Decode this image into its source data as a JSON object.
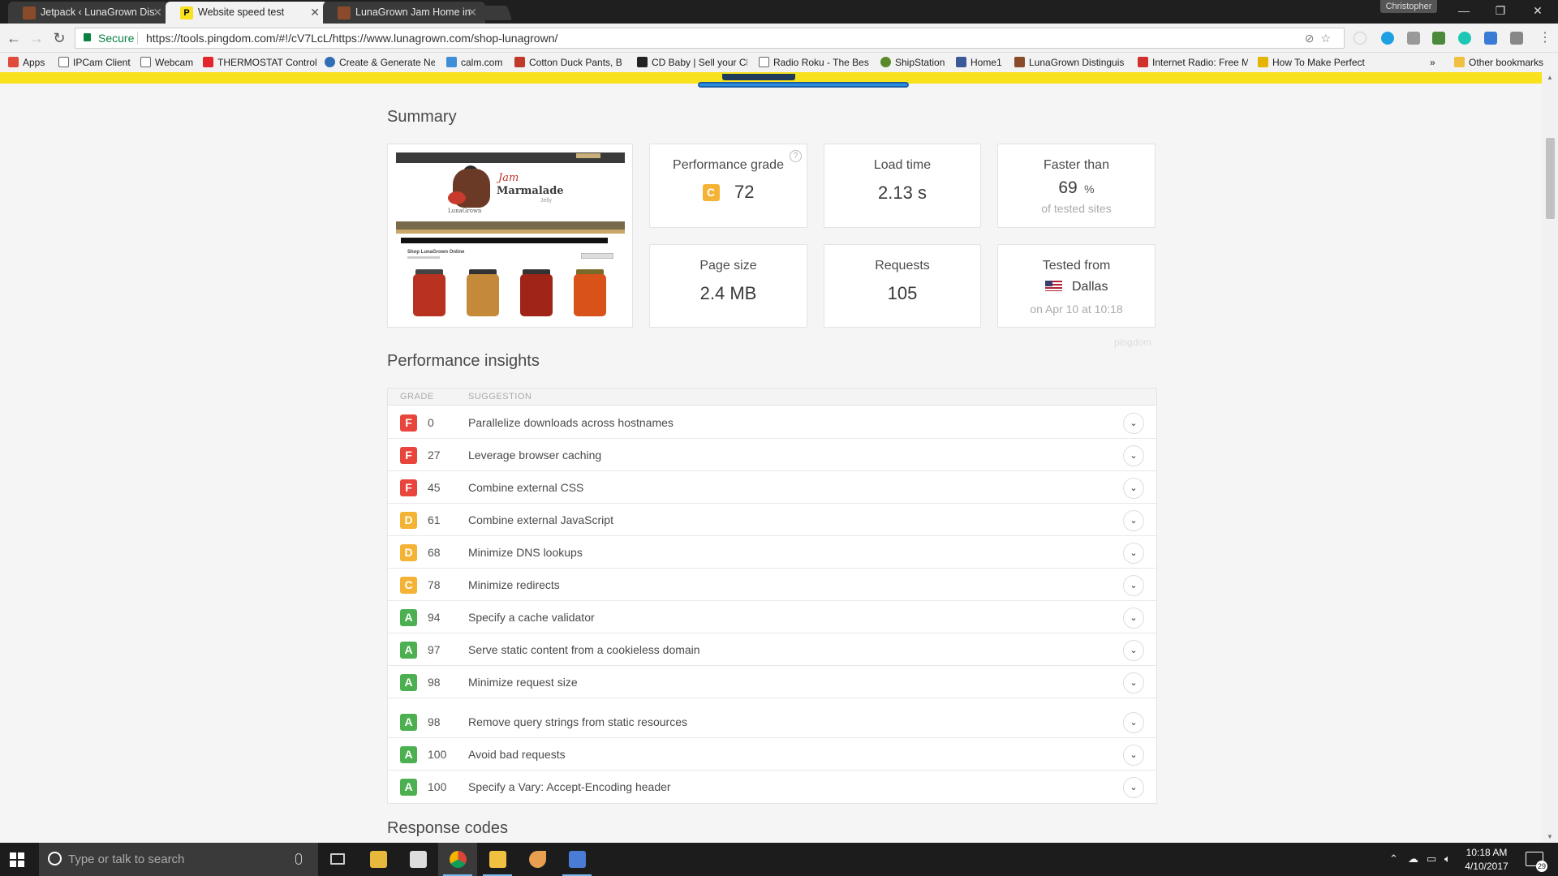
{
  "browser": {
    "tabs": [
      {
        "title": "Jetpack ‹ LunaGrown Dis",
        "icon": "lunagrown-favicon",
        "color": "#8a4b2a"
      },
      {
        "title": "Website speed test",
        "icon": "pingdom-favicon",
        "color": "#f8e11d"
      },
      {
        "title": "LunaGrown Jam Home in",
        "icon": "lunagrown-favicon",
        "color": "#8a4b2a"
      }
    ],
    "profile_name": "Christopher",
    "secure_label": "Secure",
    "url": "https://tools.pingdom.com/#!/cV7LcL/https://www.lunagrown.com/shop-lunagrown/",
    "bookmarks": [
      {
        "label": "Apps",
        "icon": "apps-grid-icon",
        "color": "#e04b3b"
      },
      {
        "label": "IPCam Client",
        "icon": "page-icon",
        "color": "#ffffff"
      },
      {
        "label": "Webcam",
        "icon": "page-icon",
        "color": "#ffffff"
      },
      {
        "label": "THERMOSTAT Control",
        "icon": "honeywell-icon",
        "color": "#e3262b"
      },
      {
        "label": "Create & Generate Ne",
        "icon": "gear-icon",
        "color": "#2f6db5"
      },
      {
        "label": "calm.com",
        "icon": "calm-icon",
        "color": "#3e8ed8"
      },
      {
        "label": "Cotton Duck Pants, B",
        "icon": "store-icon",
        "color": "#c0392b"
      },
      {
        "label": "CD Baby | Sell your CD",
        "icon": "cdbaby-icon",
        "color": "#222222"
      },
      {
        "label": "Radio Roku - The Best",
        "icon": "page-icon",
        "color": "#ffffff"
      },
      {
        "label": "ShipStation",
        "icon": "shipstation-icon",
        "color": "#5a8a2a"
      },
      {
        "label": "Home1",
        "icon": "facebook-icon",
        "color": "#3b5998"
      },
      {
        "label": "LunaGrown Distinguis",
        "icon": "lunagrown-favicon",
        "color": "#8a4b2a"
      },
      {
        "label": "Internet Radio: Free M",
        "icon": "radio-icon",
        "color": "#d0312d"
      },
      {
        "label": "How To Make Perfect",
        "icon": "recipe-icon",
        "color": "#e6b400"
      }
    ],
    "bookmarks_overflow": "»",
    "other_bookmarks": "Other bookmarks"
  },
  "summary": {
    "title": "Summary",
    "cards": {
      "performance_grade": {
        "label": "Performance grade",
        "grade": "C",
        "value": "72"
      },
      "load_time": {
        "label": "Load time",
        "value": "2.13 s"
      },
      "faster_than": {
        "label": "Faster than",
        "value": "69",
        "unit": "%",
        "sub": "of tested sites"
      },
      "page_size": {
        "label": "Page size",
        "value": "2.4 MB"
      },
      "requests": {
        "label": "Requests",
        "value": "105"
      },
      "tested_from": {
        "label": "Tested from",
        "location": "Dallas",
        "sub": "on Apr 10 at 10:18"
      }
    },
    "watermark": "pingdom",
    "screenshot": {
      "brand_jam": "Jam",
      "brand_marmalade": "Marmalade",
      "brand_jelly": "Jelly",
      "brand_lunagrown": "LunaGrown",
      "shop_heading": "Shop LunaGrown Online"
    }
  },
  "insights": {
    "title": "Performance insights",
    "col_grade": "GRADE",
    "col_suggestion": "SUGGESTION",
    "rows": [
      {
        "grade": "F",
        "score": "0",
        "text": "Parallelize downloads across hostnames"
      },
      {
        "grade": "F",
        "score": "27",
        "text": "Leverage browser caching"
      },
      {
        "grade": "F",
        "score": "45",
        "text": "Combine external CSS"
      },
      {
        "grade": "D",
        "score": "61",
        "text": "Combine external JavaScript"
      },
      {
        "grade": "D",
        "score": "68",
        "text": "Minimize DNS lookups"
      },
      {
        "grade": "C",
        "score": "78",
        "text": "Minimize redirects"
      },
      {
        "grade": "A",
        "score": "94",
        "text": "Specify a cache validator"
      },
      {
        "grade": "A",
        "score": "97",
        "text": "Serve static content from a cookieless domain"
      },
      {
        "grade": "A",
        "score": "98",
        "text": "Minimize request size"
      },
      {
        "grade": "A",
        "score": "98",
        "text": "Remove query strings from static resources"
      },
      {
        "grade": "A",
        "score": "100",
        "text": "Avoid bad requests"
      },
      {
        "grade": "A",
        "score": "100",
        "text": "Specify a Vary: Accept-Encoding header"
      }
    ]
  },
  "response_codes": {
    "title": "Response codes"
  },
  "grade_colors": {
    "A": "#4caf50",
    "C": "#f5b335",
    "D": "#f5b335",
    "F": "#e8453c"
  },
  "taskbar": {
    "search_placeholder": "Type or talk to search",
    "time": "10:18 AM",
    "date": "4/10/2017",
    "notification_count": "29"
  }
}
